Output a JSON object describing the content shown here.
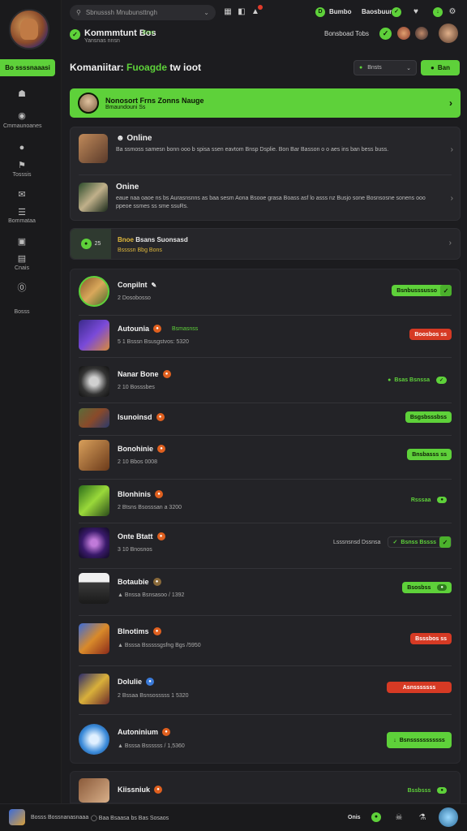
{
  "sidebar": {
    "primary_button": "Bo ssssnaaasi",
    "items": [
      {
        "icon": "home-icon",
        "label": ""
      },
      {
        "icon": "community-icon",
        "label": "Cmmaunoanes"
      },
      {
        "icon": "compass-icon",
        "label": ""
      },
      {
        "icon": "library-icon",
        "label": "Tosssis"
      },
      {
        "icon": "mail-icon",
        "label": ""
      },
      {
        "icon": "book-icon",
        "label": "Bommataa"
      },
      {
        "icon": "square-icon",
        "label": ""
      },
      {
        "icon": "list-icon",
        "label": "Cnais"
      },
      {
        "icon": "info-icon",
        "label": ""
      },
      {
        "icon": "settings-icon",
        "label": "Bosss"
      }
    ]
  },
  "topbar": {
    "search_placeholder": "Sbnusssh Mnubunsttngh",
    "status_label": "Bumbo",
    "friends_label": "Baosbuur"
  },
  "header": {
    "title": "Kommmtunt Bos",
    "title_tag": "Ems",
    "subtitle": "Yansnas nnsn",
    "friends_online": "Bonsboad Tobs"
  },
  "section": {
    "title_pre": "Komaniitar:",
    "title_hl": "Fuoagde",
    "title_post": "tw ioot",
    "filter_label": "Bnsts",
    "filter_button": "Ban"
  },
  "banner": {
    "title": "Nonosort Frns Zonns Nauge",
    "subtitle": "Bmaundouni Ss"
  },
  "online": [
    {
      "title": "Online",
      "text": "Ba ssmoss samesn bonn ooo b spisa ssen eavtom Bnsp Dsplie. Bon Bar Basson o o aes ins ban bess buss."
    },
    {
      "title": "Onine",
      "text": "eaue naa oaoe ns bs Aurasnsnns as baa sesm Aona Bsooe grasa Boass asf lo asss nz Busjo sone Bosnsosne sonens ooo ppeoe ssmes ss sme ssuRs."
    }
  ],
  "promo": {
    "count": "25",
    "title_pre": "Bnoe",
    "title_post": "Bsans Suonsasd",
    "subtitle": "Bssssn Bbg Bons"
  },
  "games": [
    {
      "name": "Conpilnt",
      "meta": "2 Dosobosso",
      "action": "Bsnbusssusso",
      "action_style": "green-check",
      "tag": ""
    },
    {
      "name": "Autounia",
      "meta": "5 1 Bsssn Bsusgstvos: 5320",
      "action": "Boosbos ss",
      "action_style": "red",
      "tag": "Bsmasnss"
    },
    {
      "name": "Nanar Bone",
      "meta": "2 10 Bosssbes",
      "action": "Bsas Bsnssa",
      "action_style": "outline-count",
      "tag": ""
    },
    {
      "name": "Isunoinsd",
      "meta": "",
      "action": "Bsgsbsssbss",
      "action_style": "green",
      "tag": ""
    },
    {
      "name": "Bonohinie",
      "meta": "2 10 Bbos 0008",
      "action": "Bnsbasss ss",
      "action_style": "green",
      "tag": ""
    },
    {
      "name": "Blonhinis",
      "meta": "2 Btsns Bsosssan a 3200",
      "action": "Rsssaa",
      "action_style": "outline-count",
      "tag": ""
    },
    {
      "name": "Onte Btatt",
      "meta": "3 10 Bnosnos",
      "action": "Bsnss Bssss",
      "action_style": "outline-check",
      "tag": "",
      "note": "Lsssnsnsd Dssnsa"
    },
    {
      "name": "Botaubie",
      "meta": "Bnssa Bsnsasoo / 1392",
      "action": "Bsosbss",
      "action_style": "green-count",
      "tag": ""
    },
    {
      "name": "Blnotims",
      "meta": "Bsssa Bsssssgsfng Bgs /5950",
      "action": "Bsssbos ss",
      "action_style": "red",
      "tag": ""
    },
    {
      "name": "Dolulie",
      "meta": "2 Bssaa Bsnsosssss 1 5320",
      "action": "Asnsssssss",
      "action_style": "red",
      "tag": ""
    },
    {
      "name": "Autoninium",
      "meta": "Bsssa Bssssss / 1,5360",
      "action": "Bsnsssssssssss",
      "action_style": "green",
      "tag": ""
    },
    {
      "name": "Kiissniuk",
      "meta": "",
      "action": "Bssbsss",
      "action_style": "outline-count",
      "tag": ""
    }
  ],
  "footer": {
    "left_text": "Bosss Bossnanasnaaa",
    "center_text": "Baa Bsaasa bs Bas Sosaos",
    "status": "Onis"
  }
}
